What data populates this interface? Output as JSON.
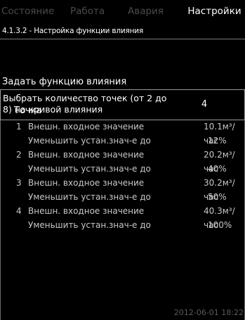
{
  "tabs": [
    {
      "label": "Состояние"
    },
    {
      "label": "Работа"
    },
    {
      "label": "Авария"
    },
    {
      "label": "Настройки"
    }
  ],
  "breadcrumb": "4.1.3.2 - Настройка функции влияния",
  "section_title": "Задать функцию влияния",
  "points_select": {
    "label": "Выбрать количество точек (от 2 до 8) на кривой влияния",
    "value": "4"
  },
  "list_header": "Точка",
  "points": [
    {
      "num": "1",
      "input_label": "Внешн. входное значение",
      "input_value": "10.1м³/час",
      "reduce_label": "Уменьшить устан.знач-е до",
      "reduce_value": "12%"
    },
    {
      "num": "2",
      "input_label": "Внешн. входное значение",
      "input_value": "20.2м³/час",
      "reduce_label": "Уменьшить устан.знач-е до",
      "reduce_value": "40%"
    },
    {
      "num": "3",
      "input_label": "Внешн. входное значение",
      "input_value": "30.2м³/час",
      "reduce_label": "Уменьшить устан.знач-е до",
      "reduce_value": "50%"
    },
    {
      "num": "4",
      "input_label": "Внешн. входное значение",
      "input_value": "40.3м³/час",
      "reduce_label": "Уменьшить устан.знач-е до",
      "reduce_value": "100%"
    }
  ],
  "footer_time": "2012-06-01 18:22"
}
